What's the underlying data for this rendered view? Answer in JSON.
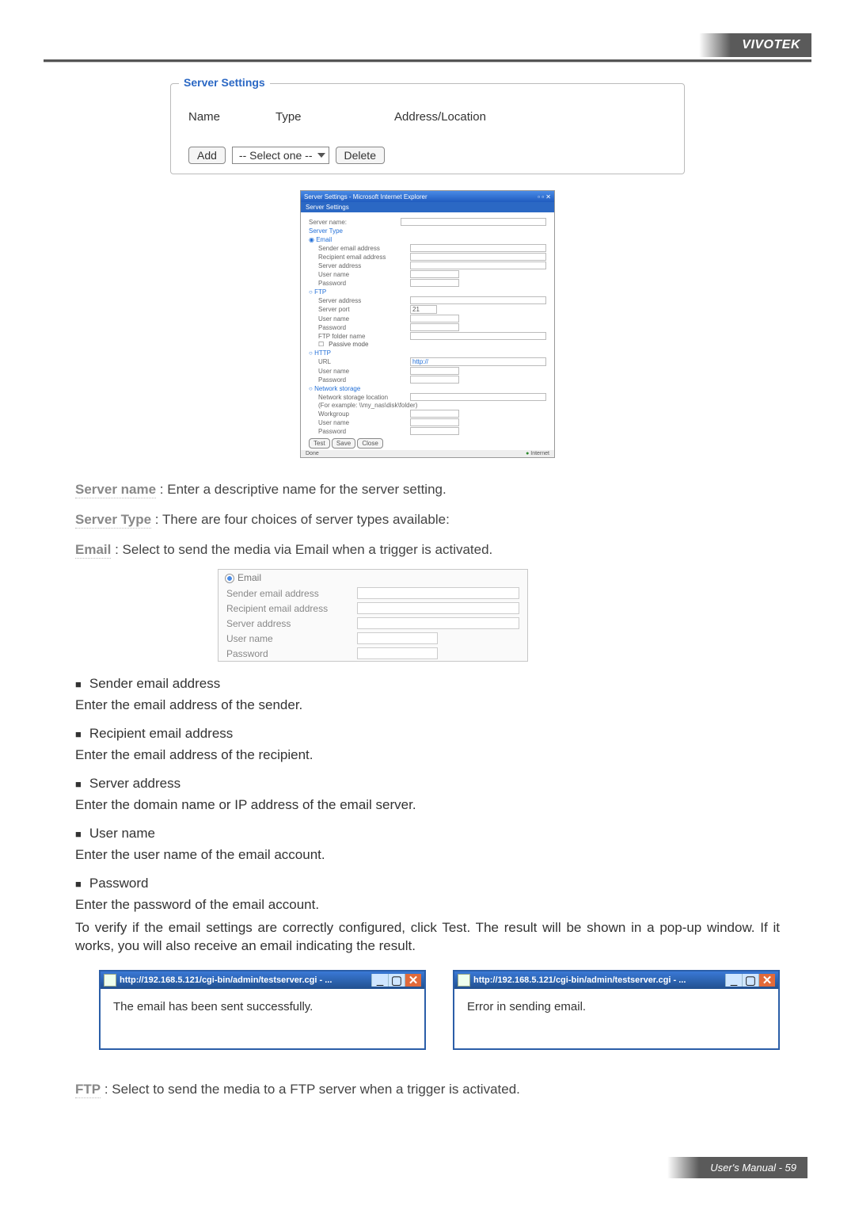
{
  "brand": "VIVOTEK",
  "footer": {
    "label": "User's Manual",
    "sep": " - ",
    "page": "59"
  },
  "fieldset": {
    "legend": "Server Settings",
    "columns": {
      "c1": "Name",
      "c2": "Type",
      "c3": "Address/Location"
    },
    "add": "Add",
    "select": "-- Select one --",
    "delete": "Delete"
  },
  "shot1": {
    "titlebar": "Server Settings - Microsoft Internet Explorer",
    "headerBar": "Server Settings",
    "serverName": "Server name:",
    "serverType": "Server Type",
    "email": {
      "label": "Email",
      "sender": "Sender email address",
      "recipient": "Recipient email address",
      "server": "Server address",
      "user": "User name",
      "pass": "Password"
    },
    "ftp": {
      "label": "FTP",
      "server": "Server address",
      "port": "Server port",
      "portVal": "21",
      "user": "User name",
      "pass": "Password",
      "folder": "FTP folder name",
      "passive": "Passive mode"
    },
    "http": {
      "label": "HTTP",
      "url": "URL",
      "urlVal": "http://",
      "user": "User name",
      "pass": "Password"
    },
    "ns": {
      "label": "Network storage",
      "loc": "Network storage location",
      "hint": "(For example: \\\\my_nas\\disk\\folder)",
      "wg": "Workgroup",
      "user": "User name",
      "pass": "Password"
    },
    "btns": {
      "test": "Test",
      "save": "Save",
      "close": "Close"
    },
    "status": {
      "done": "Done",
      "zone": "Internet"
    }
  },
  "defs": {
    "servername": {
      "term": "Server name",
      "colon": " :",
      "text": " Enter a descriptive name for the server setting."
    },
    "servertype": {
      "term": "Server Type",
      "colon": " :",
      "text": " There are four choices of server types available:"
    },
    "email": {
      "term": "Email",
      "colon": " :",
      "text": " Select to send the media via Email when a trigger is activated."
    },
    "ftp": {
      "term": "FTP",
      "colon": " :",
      "text": " Select to send the media to a  FTP server when a trigger is activated."
    }
  },
  "shot2": {
    "radio": "Email",
    "sender": "Sender email address",
    "recipient": "Recipient email address",
    "server": "Server address",
    "user": "User name",
    "pass": "Password"
  },
  "bullets": {
    "b1": "Sender email address",
    "p1": "Enter the email address of the sender.",
    "b2": "Recipient email address",
    "p2": "Enter the email address of the recipient.",
    "b3": "Server address",
    "p3": "Enter the domain name or IP address of the email server.",
    "b4": "User name",
    "p4": "Enter the user name of the email account.",
    "b5": "Password",
    "p5": "Enter the password of the email account.",
    "verify": "To verify if the email settings are correctly configured, click Test. The result will be shown in a pop-up window. If it works, you will also receive an email indicating the result."
  },
  "popups": {
    "url": "http://192.168.5.121/cgi-bin/admin/testserver.cgi - ...",
    "ok": "The email has been sent successfully.",
    "err": "Error in sending email."
  }
}
